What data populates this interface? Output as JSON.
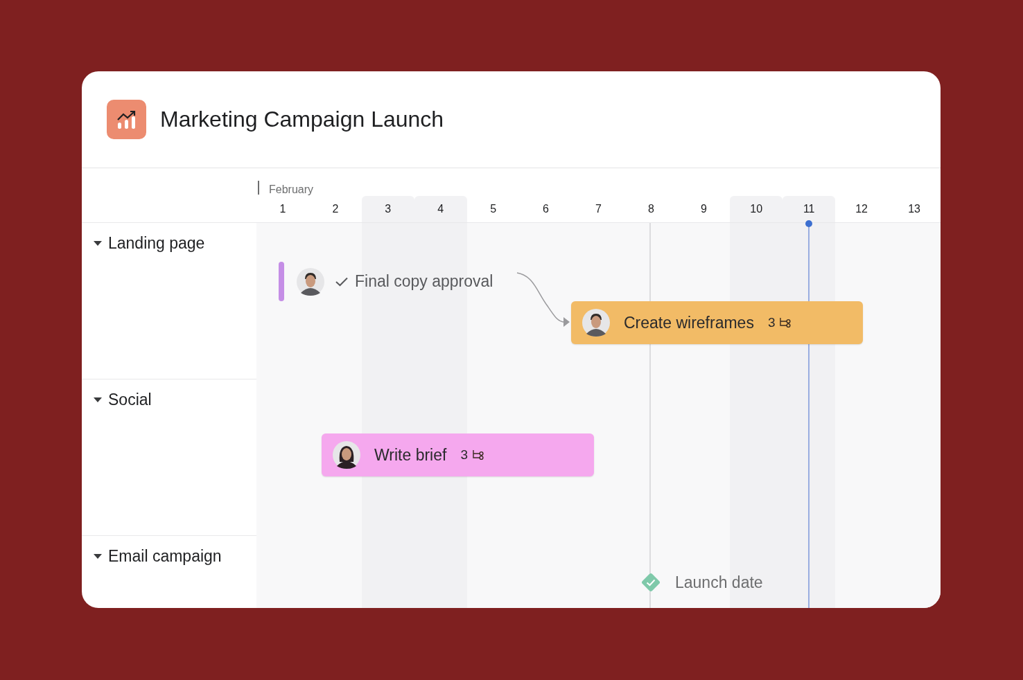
{
  "project": {
    "title": "Marketing Campaign Launch"
  },
  "timeline": {
    "month": "February",
    "days": [
      {
        "label": "1",
        "weekend": false,
        "today": false
      },
      {
        "label": "2",
        "weekend": false,
        "today": false
      },
      {
        "label": "3",
        "weekend": true,
        "today": false
      },
      {
        "label": "4",
        "weekend": true,
        "today": false
      },
      {
        "label": "5",
        "weekend": false,
        "today": false
      },
      {
        "label": "6",
        "weekend": false,
        "today": false
      },
      {
        "label": "7",
        "weekend": false,
        "today": false
      },
      {
        "label": "8",
        "weekend": false,
        "today": false
      },
      {
        "label": "9",
        "weekend": false,
        "today": false
      },
      {
        "label": "10",
        "weekend": true,
        "today": false
      },
      {
        "label": "11",
        "weekend": true,
        "today": true
      },
      {
        "label": "12",
        "weekend": false,
        "today": false
      },
      {
        "label": "13",
        "weekend": false,
        "today": false
      }
    ]
  },
  "groups": [
    {
      "name": "Landing page",
      "expanded": true
    },
    {
      "name": "Social",
      "expanded": true
    },
    {
      "name": "Email campaign",
      "expanded": true
    }
  ],
  "tasks": [
    {
      "kind": "completed",
      "name": "Final copy approval",
      "color": "#c58ee6"
    },
    {
      "kind": "bar",
      "name": "Create wireframes",
      "subtasks": "3",
      "color": "#f2bb66"
    },
    {
      "kind": "bar",
      "name": "Write brief",
      "subtasks": "3",
      "color": "#f5a8ee"
    },
    {
      "kind": "milestone",
      "name": "Launch date",
      "color": "#7fc9aa"
    }
  ]
}
